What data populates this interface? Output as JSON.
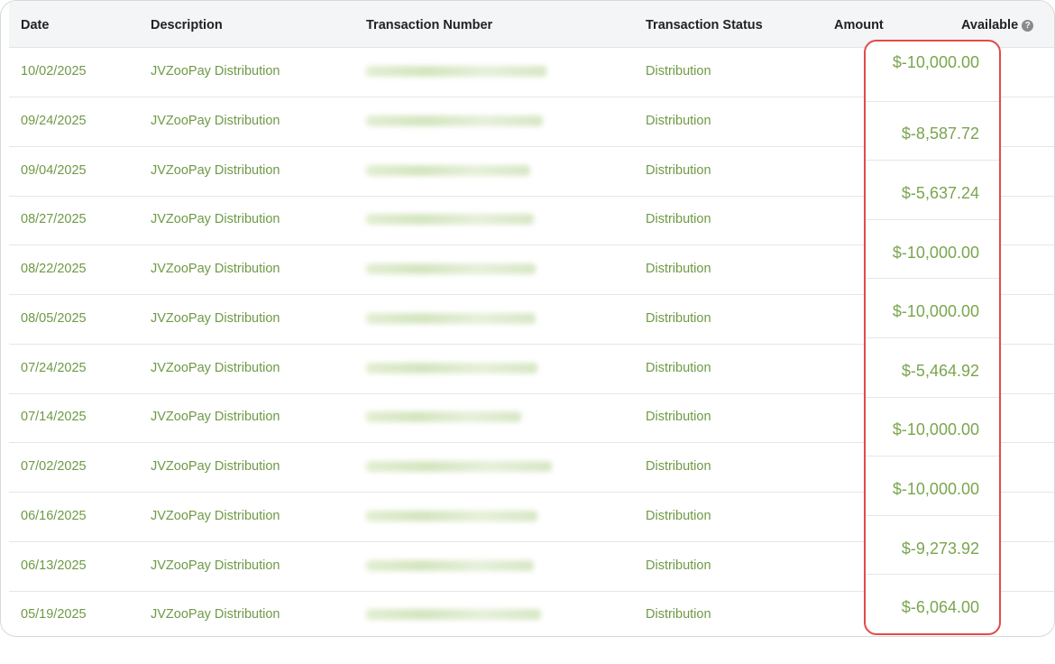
{
  "table": {
    "headers": {
      "date": "Date",
      "description": "Description",
      "transaction_number": "Transaction Number",
      "transaction_status": "Transaction Status",
      "amount": "Amount",
      "available": "Available"
    },
    "help_icon": "question-circle-icon",
    "rows": [
      {
        "date": "10/02/2025",
        "description": "JVZooPay Distribution",
        "status": "Distribution",
        "amount": "$-10,000.00"
      },
      {
        "date": "09/24/2025",
        "description": "JVZooPay Distribution",
        "status": "Distribution",
        "amount": "$-8,587.72"
      },
      {
        "date": "09/04/2025",
        "description": "JVZooPay Distribution",
        "status": "Distribution",
        "amount": "$-5,637.24"
      },
      {
        "date": "08/27/2025",
        "description": "JVZooPay Distribution",
        "status": "Distribution",
        "amount": "$-10,000.00"
      },
      {
        "date": "08/22/2025",
        "description": "JVZooPay Distribution",
        "status": "Distribution",
        "amount": "$-10,000.00"
      },
      {
        "date": "08/05/2025",
        "description": "JVZooPay Distribution",
        "status": "Distribution",
        "amount": "$-5,464.92"
      },
      {
        "date": "07/24/2025",
        "description": "JVZooPay Distribution",
        "status": "Distribution",
        "amount": "$-10,000.00"
      },
      {
        "date": "07/14/2025",
        "description": "JVZooPay Distribution",
        "status": "Distribution",
        "amount": "$-10,000.00"
      },
      {
        "date": "07/02/2025",
        "description": "JVZooPay Distribution",
        "status": "Distribution",
        "amount": "$-9,273.92"
      },
      {
        "date": "06/16/2025",
        "description": "JVZooPay Distribution",
        "status": "Distribution",
        "amount": "$-6,064.00"
      },
      {
        "date": "06/13/2025",
        "description": "JVZooPay Distribution",
        "status": "Distribution"
      },
      {
        "date": "05/19/2025",
        "description": "JVZooPay Distribution",
        "status": "Distribution"
      }
    ]
  },
  "colors": {
    "text_green": "#6e9a45",
    "amount_green": "#7aa54e",
    "highlight_red": "#e24a4a",
    "header_bg": "#f4f5f7"
  }
}
